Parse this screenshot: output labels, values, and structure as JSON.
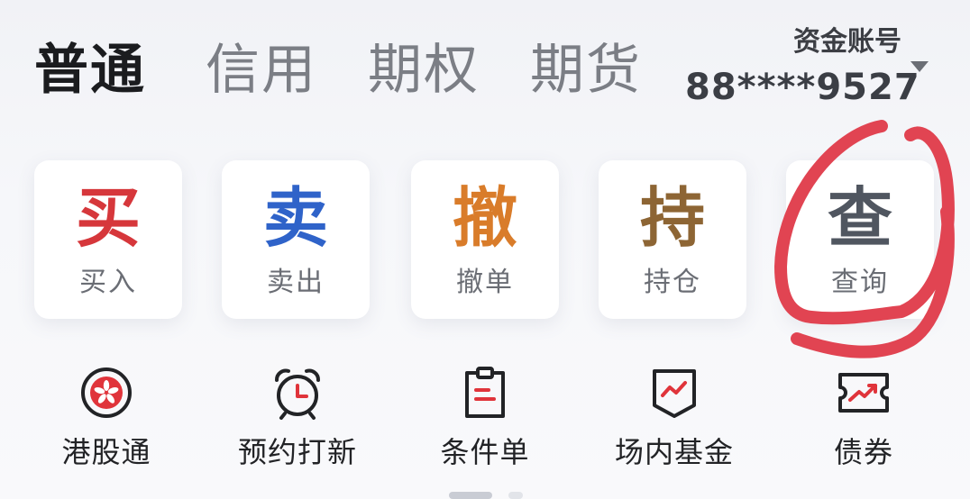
{
  "tabs": [
    {
      "label": "普通",
      "active": true
    },
    {
      "label": "信用",
      "active": false
    },
    {
      "label": "期权",
      "active": false
    },
    {
      "label": "期货",
      "active": false
    }
  ],
  "account": {
    "label": "资金账号",
    "number": "88****9527",
    "caret_icon": "caret-down-icon"
  },
  "trade_actions": [
    {
      "glyph": "买",
      "label": "买入",
      "color": "#d6373b"
    },
    {
      "glyph": "卖",
      "label": "卖出",
      "color": "#2f63c9"
    },
    {
      "glyph": "撤",
      "label": "撤单",
      "color": "#d97c2a"
    },
    {
      "glyph": "持",
      "label": "持仓",
      "color": "#8d6534"
    },
    {
      "glyph": "查",
      "label": "查询",
      "color": "#505660"
    }
  ],
  "quick_functions": [
    {
      "label": "港股通",
      "icon": "bauhinia-icon"
    },
    {
      "label": "预约打新",
      "icon": "alarm-clock-icon"
    },
    {
      "label": "条件单",
      "icon": "clipboard-icon"
    },
    {
      "label": "场内基金",
      "icon": "fund-shield-icon"
    },
    {
      "label": "债券",
      "icon": "bond-ticket-icon"
    }
  ],
  "colors": {
    "accent_red": "#e0343b",
    "annotation_red": "#e14452",
    "icon_stroke": "#222326"
  }
}
